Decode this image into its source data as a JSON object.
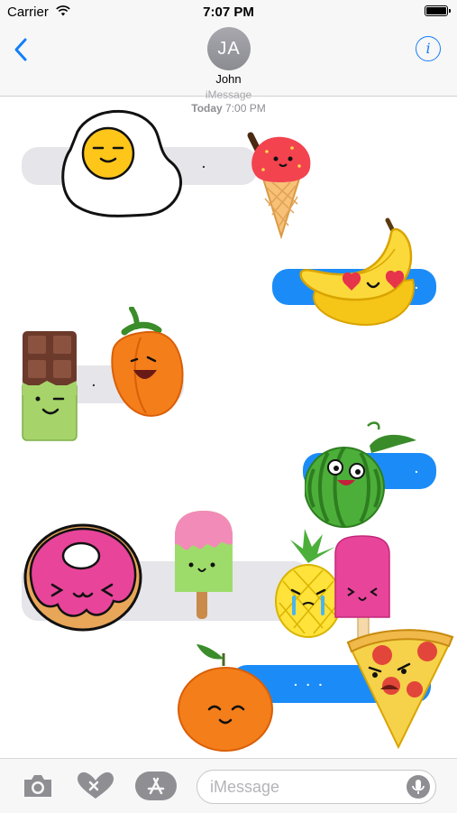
{
  "status_bar": {
    "carrier": "Carrier",
    "time": "7:07 PM"
  },
  "nav": {
    "back_icon": "chevron-left-icon",
    "avatar_initials": "JA",
    "contact_name": "John",
    "info_icon": "info-icon",
    "info_glyph": "i"
  },
  "conversation": {
    "service": "iMessage",
    "date_label": "Today",
    "time_label": "7:00 PM",
    "messages": [
      {
        "sender": "contact",
        "text": "."
      },
      {
        "sender": "me",
        "text": "."
      },
      {
        "sender": "contact",
        "text": "."
      },
      {
        "sender": "me",
        "text": "."
      },
      {
        "sender": "contact",
        "text": ""
      },
      {
        "sender": "me",
        "text": ". . ."
      }
    ],
    "stickers": [
      "egg",
      "ice-cream",
      "banana",
      "chocolate",
      "pepper",
      "watermelon",
      "donut",
      "popsicle-green",
      "pineapple",
      "popsicle-pink",
      "orange",
      "pizza"
    ]
  },
  "toolbar": {
    "camera_icon": "camera-icon",
    "digital_touch_icon": "heart-icon",
    "app_store_icon": "app-store-icon",
    "mic_icon": "microphone-icon"
  },
  "composer": {
    "placeholder": "iMessage"
  },
  "colors": {
    "accent": "#147efb",
    "bubble_out": "#1b8cf7",
    "bubble_in": "#e5e5ea"
  }
}
